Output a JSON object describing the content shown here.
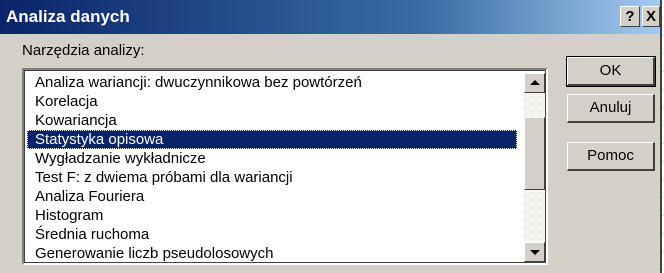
{
  "window": {
    "title": "Analiza danych",
    "help_button": "?",
    "close_button": "X"
  },
  "label": "Narzędzia analizy:",
  "list": {
    "items": [
      "Analiza wariancji: dwuczynnikowa bez powtórzeń",
      "Korelacja",
      "Kowariancja",
      "Statystyka opisowa",
      "Wygładzanie wykładnicze",
      "Test F: z dwiema próbami dla wariancji",
      "Analiza Fouriera",
      "Histogram",
      "Średnia ruchoma",
      "Generowanie liczb pseudolosowych"
    ],
    "selected": "Statystyka opisowa"
  },
  "buttons": {
    "ok": "OK",
    "cancel": "Anuluj",
    "help": "Pomoc"
  },
  "colors": {
    "title_gradient_start": "#0a246a",
    "title_gradient_end": "#a6caf0",
    "selection": "#0a246a",
    "dialog_face": "#d4d0c8"
  }
}
